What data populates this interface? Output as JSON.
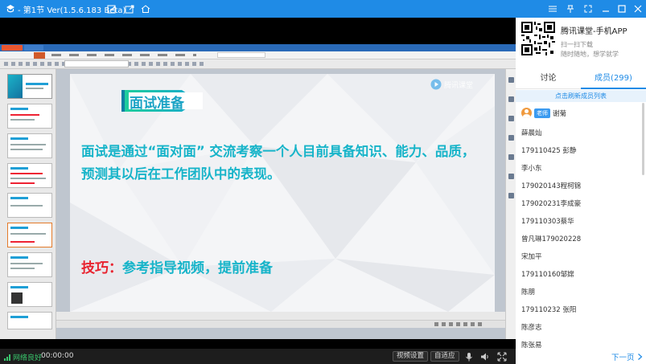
{
  "window": {
    "title": "- 第1节 Ver(1.5.6.183 Beta)",
    "accent_color": "#1f8be6"
  },
  "slide": {
    "title": "面试准备",
    "body": "面试是通过“面对面” 交流考察一个人目前具备知识、能力、品质，预测其以后在工作团队中的表现。",
    "tip_label": "技巧：",
    "tip_text": "参考指导视频，提前准备",
    "watermark": "腾讯课堂",
    "title_color": "#1aa3c5",
    "body_color": "#17b4c9",
    "tip_color": "#e8232f"
  },
  "controls": {
    "network_status": "网络良好",
    "time": "00:00:00",
    "video_settings_label": "视频设置",
    "adaptive_label": "自适应"
  },
  "panel": {
    "app_name": "腾讯课堂-手机APP",
    "app_sub1": "扫一扫下载",
    "app_sub2": "随时随地，想学就学",
    "tabs": {
      "discuss": "讨论",
      "members": "成员(299)"
    },
    "refresh_label": "点击刷新成员列表",
    "teacher": {
      "badge": "老师",
      "name": "谢菊"
    },
    "members": [
      "薛晨灿",
      "179110425 彭静",
      "李小东",
      "179020143程柯锦",
      "179020231李成豪",
      "179110303蔡华",
      "曾凡琳179020228",
      "宋加平",
      "179110160邹嫦",
      "陈朋",
      "179110232 张阳",
      "陈彦志",
      "陈张易"
    ],
    "next_page_label": "下一页"
  }
}
